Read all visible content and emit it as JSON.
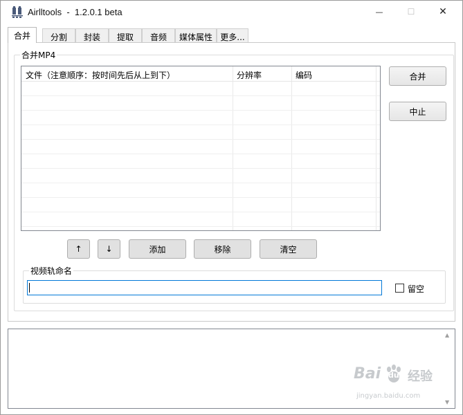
{
  "window": {
    "title": "Airlltools  -  1.2.0.1 beta",
    "controls": {
      "minimize": "—",
      "maximize": "☐",
      "close": "✕"
    }
  },
  "tabs": [
    {
      "label": "合并",
      "active": true
    },
    {
      "label": "分割"
    },
    {
      "label": "封装"
    },
    {
      "label": "提取"
    },
    {
      "label": "音频"
    },
    {
      "label": "媒体属性"
    },
    {
      "label": "更多..."
    }
  ],
  "merge": {
    "group_label": "合并MP4",
    "columns": [
      "文件（注意顺序：按时间先后从上到下）",
      "分辨率",
      "编码"
    ],
    "rows": [],
    "buttons": {
      "up": "↑",
      "down": "↓",
      "add": "添加",
      "remove": "移除",
      "clear": "清空",
      "merge": "合并",
      "abort": "中止"
    },
    "track_group_label": "视频轨命名",
    "track_name_value": "",
    "keep_empty_label": "留空",
    "keep_empty_checked": false
  },
  "log": {
    "text": ""
  },
  "watermark": {
    "brand": "Bai",
    "paw": "du",
    "suffix": "经验",
    "url": "jingyan.baidu.com"
  },
  "colors": {
    "focus_border": "#0078d7",
    "button_face": "#e1e1e1"
  },
  "icons": {
    "app": "app-logo-icon",
    "scroll_up": "▲",
    "scroll_down": "▼"
  }
}
